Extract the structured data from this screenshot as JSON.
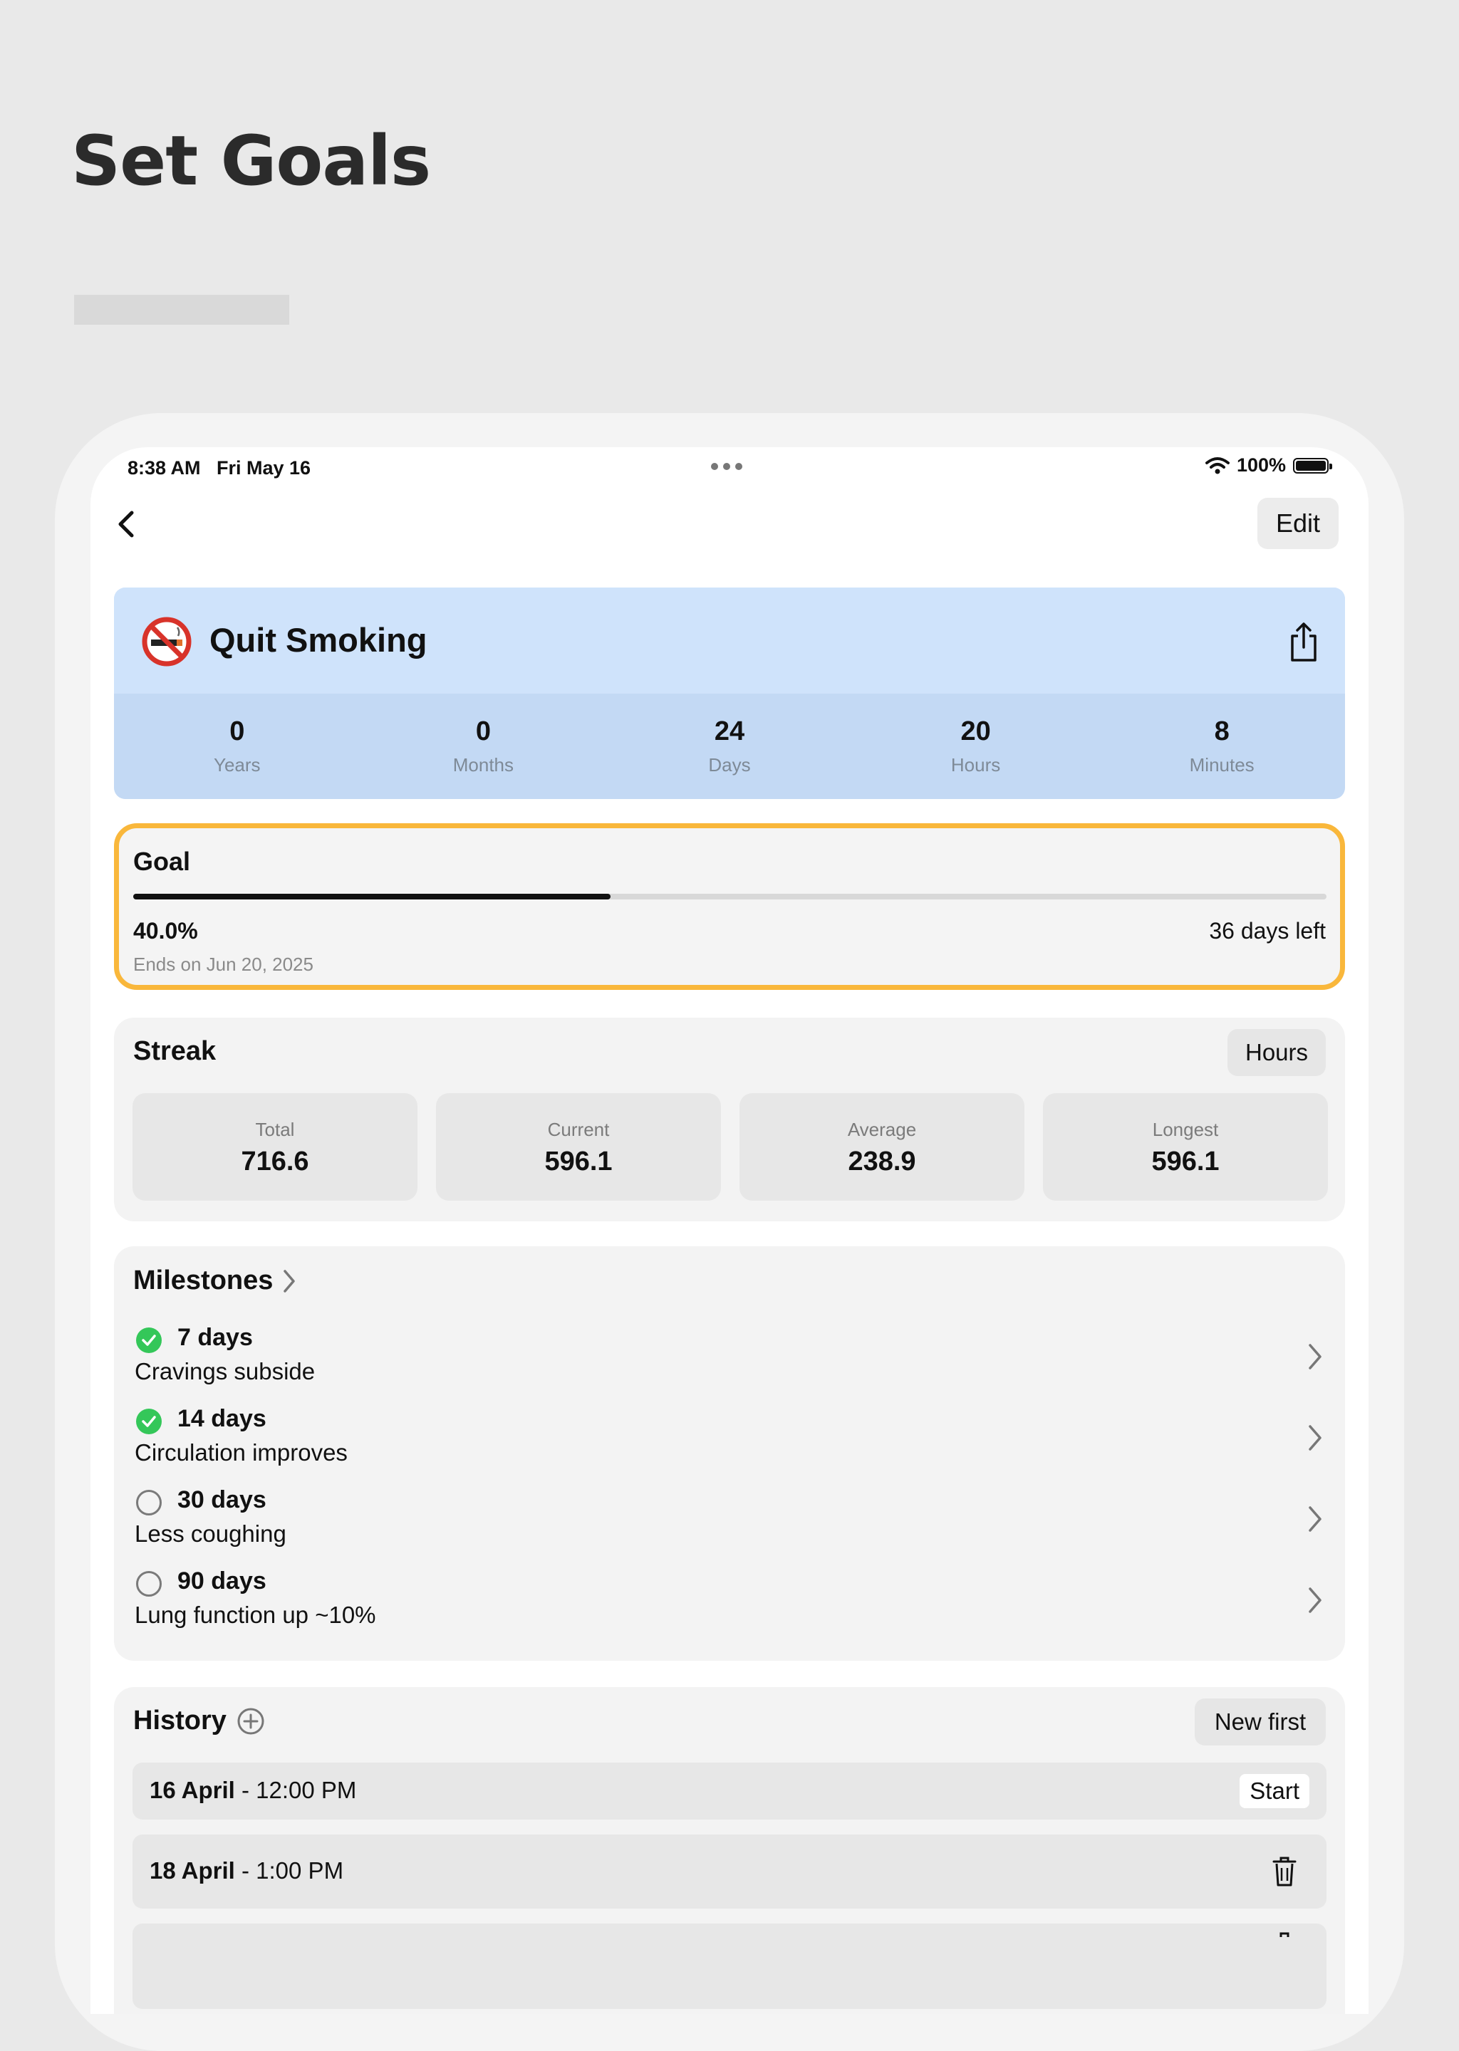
{
  "hero": {
    "title": "Set Goals"
  },
  "status_bar": {
    "time": "8:38 AM",
    "date": "Fri May 16",
    "battery": "100%"
  },
  "nav": {
    "edit_label": "Edit"
  },
  "habit": {
    "title": "Quit Smoking",
    "icon": "no-smoking-icon",
    "stats": [
      {
        "value": "0",
        "label": "Years"
      },
      {
        "value": "0",
        "label": "Months"
      },
      {
        "value": "24",
        "label": "Days"
      },
      {
        "value": "20",
        "label": "Hours"
      },
      {
        "value": "8",
        "label": "Minutes"
      }
    ]
  },
  "goal": {
    "title": "Goal",
    "progress": 0.4,
    "percent_label": "40.0%",
    "days_left": "36 days left",
    "ends_on": "Ends on Jun 20, 2025"
  },
  "streak": {
    "title": "Streak",
    "unit_label": "Hours",
    "items": [
      {
        "label": "Total",
        "value": "716.6"
      },
      {
        "label": "Current",
        "value": "596.1"
      },
      {
        "label": "Average",
        "value": "238.9"
      },
      {
        "label": "Longest",
        "value": "596.1"
      }
    ]
  },
  "milestones": {
    "title": "Milestones",
    "items": [
      {
        "days": "7 days",
        "desc": "Cravings subside",
        "done": true
      },
      {
        "days": "14 days",
        "desc": "Circulation improves",
        "done": true
      },
      {
        "days": "30 days",
        "desc": "Less coughing",
        "done": false
      },
      {
        "days": "90 days",
        "desc": "Lung function up ~10%",
        "done": false
      }
    ]
  },
  "history": {
    "title": "History",
    "sort_label": "New first",
    "rows": [
      {
        "date": "16 April",
        "time": "- 12:00 PM",
        "badge": "Start"
      },
      {
        "date": "18 April",
        "time": "- 1:00 PM"
      }
    ]
  },
  "colors": {
    "accent_goal": "#f9b73b",
    "header_bg": "#cfe3fb",
    "stats_bg": "#c3d9f4",
    "check_green": "#34c759"
  }
}
